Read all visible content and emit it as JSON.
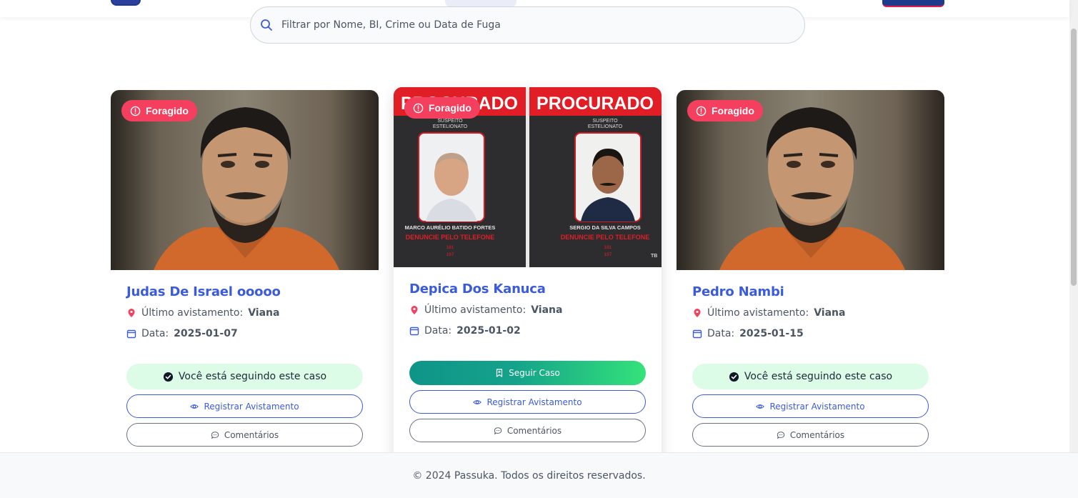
{
  "search": {
    "placeholder": "Filtrar por Nome, BI, Crime ou Data de Fuga",
    "value": ""
  },
  "labels": {
    "sighting_prefix": "Último avistamento:",
    "date_prefix": "Data:",
    "following": "Você está seguindo este caso",
    "follow": "Seguir Caso",
    "register": "Registrar Avistamento",
    "comments": "Comentários"
  },
  "cards": [
    {
      "badge": "Foragido",
      "name": "Judas De Israel ooooo",
      "location": "Viana",
      "date": "2025-01-07",
      "following": true
    },
    {
      "badge": "Foragido",
      "name": "Depica Dos Kanuca",
      "location": "Viana",
      "date": "2025-01-02",
      "following": false,
      "poster": {
        "heading_left": "PROCURADO",
        "heading_right": "PROCURADO",
        "tag": "SUSPEITO",
        "crime": "ESTELIONATO",
        "left_name": "MARCO AURÉLIO BATIDO FORTES",
        "right_name": "SERGIO DA SILVA CAMPOS",
        "cta": "DENUNCIE PELO TELEFONE",
        "phone1": "181",
        "phone2": "197",
        "corner": "TB"
      }
    },
    {
      "badge": "Foragido",
      "name": "Pedro Nambi",
      "location": "Viana",
      "date": "2025-01-15",
      "following": true
    }
  ],
  "footer": {
    "text": "© 2024 Passuka. Todos os direitos reservados."
  },
  "colors": {
    "accent": "#3b5bdb",
    "badge": "#f43f5e",
    "follow_start": "#0f9488",
    "follow_end": "#34e27a",
    "following_bg": "#dcfce7"
  }
}
